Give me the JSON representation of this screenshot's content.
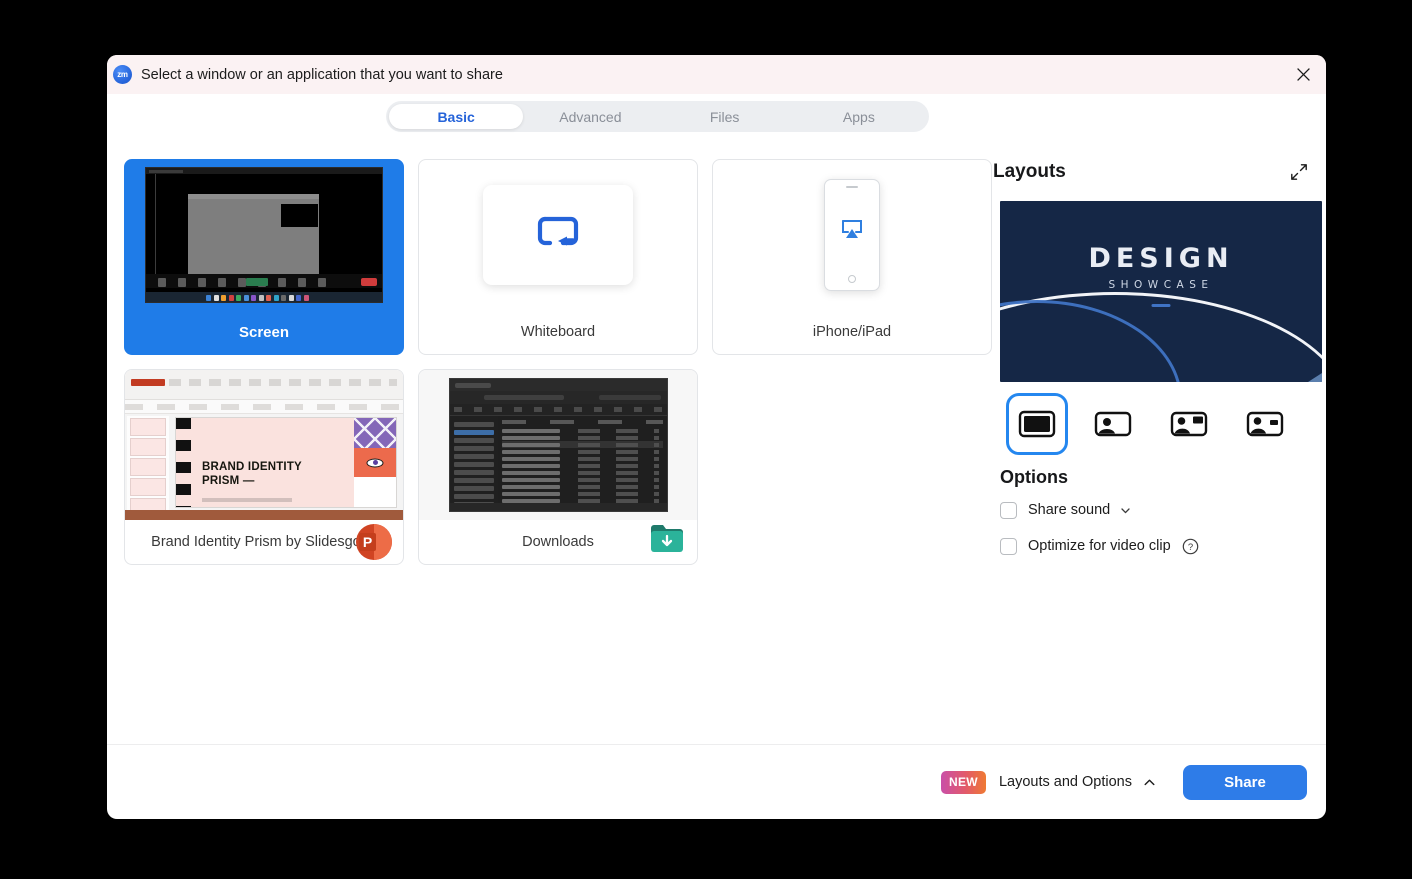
{
  "window": {
    "title": "Select a window or an application that you want to share",
    "logo_text": "zm",
    "close_label": "Close"
  },
  "tabs": [
    {
      "label": "Basic",
      "active": true
    },
    {
      "label": "Advanced",
      "active": false
    },
    {
      "label": "Files",
      "active": false
    },
    {
      "label": "Apps",
      "active": false
    }
  ],
  "sources": [
    {
      "label": "Screen",
      "selected": true,
      "kind": "screen"
    },
    {
      "label": "Whiteboard",
      "selected": false,
      "kind": "whiteboard"
    },
    {
      "label": "iPhone/iPad",
      "selected": false,
      "kind": "phone"
    },
    {
      "label": "Brand Identity Prism by Slidesgo ...",
      "selected": false,
      "kind": "powerpoint",
      "badge": "P"
    },
    {
      "label": "Downloads",
      "selected": false,
      "kind": "folder"
    }
  ],
  "slide_preview": {
    "headline": "BRAND IDENTITY",
    "headline2": "PRISM —"
  },
  "layouts": {
    "title": "Layouts",
    "expand_label": "Expand",
    "preview": {
      "title": "DESIGN",
      "subtitle": "SHOWCASE"
    },
    "options": [
      {
        "name": "full-screen-layout",
        "selected": true
      },
      {
        "name": "speaker-left-layout",
        "selected": false
      },
      {
        "name": "speaker-with-thumbnail-layout",
        "selected": false
      },
      {
        "name": "speaker-with-small-thumbnail-layout",
        "selected": false
      }
    ]
  },
  "options": {
    "title": "Options",
    "share_sound": {
      "label": "Share sound",
      "checked": false
    },
    "optimize_video": {
      "label": "Optimize for video clip",
      "checked": false
    }
  },
  "footer": {
    "new_badge": "NEW",
    "layouts_options_label": "Layouts and Options",
    "share_label": "Share"
  },
  "colors": {
    "accent_blue": "#2e7ce8",
    "selected_card": "#1f7ce8",
    "titlebar": "#fbf2f3",
    "preview_navy": "#152746"
  }
}
